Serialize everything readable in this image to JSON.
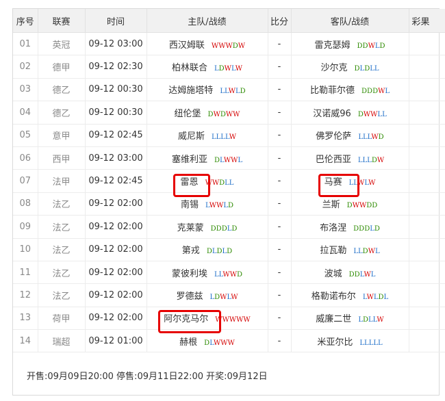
{
  "headers": [
    "序号",
    "联赛",
    "时间",
    "主队/战绩",
    "比分",
    "客队/战绩",
    "彩果"
  ],
  "rows": [
    {
      "seq": "01",
      "league": "英冠",
      "time": "09-12 03:00",
      "home": "西汉姆联",
      "home_form": "WWWDW",
      "score": "-",
      "away": "雷克瑟姆",
      "away_form": "DDWLD"
    },
    {
      "seq": "02",
      "league": "德甲",
      "time": "09-12 02:30",
      "home": "柏林联合",
      "home_form": "LDWLW",
      "score": "-",
      "away": "沙尔克",
      "away_form": "DLDLL"
    },
    {
      "seq": "03",
      "league": "德乙",
      "time": "09-12 00:30",
      "home": "达姆施塔特",
      "home_form": "LLWLD",
      "score": "-",
      "away": "比勒菲尔德",
      "away_form": "DDDWL"
    },
    {
      "seq": "04",
      "league": "德乙",
      "time": "09-12 00:30",
      "home": "纽伦堡",
      "home_form": "DWDWW",
      "score": "-",
      "away": "汉诺威96",
      "away_form": "DWWLL"
    },
    {
      "seq": "05",
      "league": "意甲",
      "time": "09-12 02:45",
      "home": "威尼斯",
      "home_form": "LLLLW",
      "score": "-",
      "away": "佛罗伦萨",
      "away_form": "LLLWD"
    },
    {
      "seq": "06",
      "league": "西甲",
      "time": "09-12 03:00",
      "home": "塞维利亚",
      "home_form": "DLWWL",
      "score": "-",
      "away": "巴伦西亚",
      "away_form": "LLLDW"
    },
    {
      "seq": "07",
      "league": "法甲",
      "time": "09-12 02:45",
      "home": "雷恩",
      "home_form": "WWDLL",
      "score": "-",
      "away": "马赛",
      "away_form": "LLWLW"
    },
    {
      "seq": "08",
      "league": "法乙",
      "time": "09-12 02:00",
      "home": "南锡",
      "home_form": "LWWLD",
      "score": "-",
      "away": "兰斯",
      "away_form": "DWWDD"
    },
    {
      "seq": "09",
      "league": "法乙",
      "time": "09-12 02:00",
      "home": "克莱蒙",
      "home_form": "DDDLD",
      "score": "-",
      "away": "布洛涅",
      "away_form": "DDDLD"
    },
    {
      "seq": "10",
      "league": "法乙",
      "time": "09-12 02:00",
      "home": "第戎",
      "home_form": "DLDLD",
      "score": "-",
      "away": "拉瓦勒",
      "away_form": "LLDWL"
    },
    {
      "seq": "11",
      "league": "法乙",
      "time": "09-12 02:00",
      "home": "蒙彼利埃",
      "home_form": "LLWWD",
      "score": "-",
      "away": "波城",
      "away_form": "DDLWL"
    },
    {
      "seq": "12",
      "league": "法乙",
      "time": "09-12 02:00",
      "home": "罗德兹",
      "home_form": "LDWLW",
      "score": "-",
      "away": "格勒诺布尔",
      "away_form": "LWLDL"
    },
    {
      "seq": "13",
      "league": "荷甲",
      "time": "09-12 02:00",
      "home": "阿尔克马尔",
      "home_form": "WWWWW",
      "score": "-",
      "away": "威廉二世",
      "away_form": "LDLLW"
    },
    {
      "seq": "14",
      "league": "瑞超",
      "time": "09-12 01:00",
      "home": "赫根",
      "home_form": "DLWWW",
      "score": "-",
      "away": "米亚尔比",
      "away_form": "LLLLL"
    }
  ],
  "footer": "开售:09月09日20:00 停售:09月11日22:00 开奖:09月12日",
  "colors": {
    "win": "#d40000",
    "draw": "#2c8a00",
    "loss": "#1e6ec8",
    "highlight": "#e60000"
  }
}
